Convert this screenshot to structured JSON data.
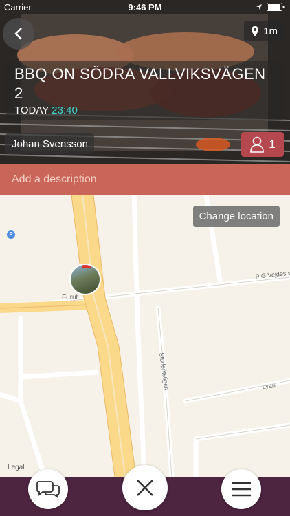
{
  "status_bar": {
    "carrier": "Carrier",
    "time": "9:46 PM"
  },
  "hero": {
    "distance": "1m",
    "title": "BBQ ON SÖDRA VALLVIKSVÄGEN 2",
    "day": "TODAY",
    "time": "23:40",
    "host": "Johan Svensson",
    "attendee_count": "1"
  },
  "description": {
    "placeholder": "Add a description"
  },
  "map": {
    "change_location_label": "Change location",
    "legal_label": "Legal",
    "street_labels": [
      "Furut",
      "P G Vejdes v",
      "Studentstigen",
      "Lyan"
    ],
    "parking_label": "P"
  },
  "colors": {
    "accent_teal": "#46d3c8",
    "description_bar": "#c96659",
    "attendee_button": "#b5474f",
    "bottom_bar": "#4d2540"
  },
  "icons": [
    "back-chevron-icon",
    "location-pin-icon",
    "person-icon",
    "chat-bubbles-icon",
    "close-x-icon",
    "hamburger-menu-icon"
  ]
}
